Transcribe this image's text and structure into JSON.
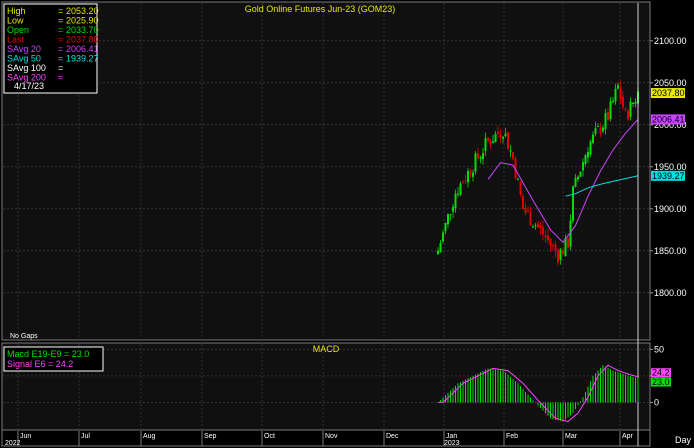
{
  "chart_data": [
    {
      "type": "candlestick",
      "title": "Gold  Online  Futures  Jun-23  (GOM23)",
      "info_box": {
        "rows": [
          {
            "label": "High",
            "value": "2053.20",
            "color": "#e8e800"
          },
          {
            "label": "Low",
            "value": "2025.90",
            "color": "#e8e800"
          },
          {
            "label": "Open",
            "value": "2033.70",
            "color": "#00e000"
          },
          {
            "label": "Last",
            "value": "2037.80",
            "color": "#e00000"
          },
          {
            "label": "SAvg  20",
            "value": "2006.41",
            "color": "#cc44ff"
          },
          {
            "label": "SAvg  50",
            "value": "1939.27",
            "color": "#00e0e0"
          },
          {
            "label": "SAvg  100",
            "value": "",
            "color": "#ffffff"
          },
          {
            "label": "SAvg  200",
            "value": "",
            "color": "#ff44ff"
          }
        ],
        "date": "4/17/23"
      },
      "note": "No Gaps",
      "ylim": [
        1745,
        2145
      ],
      "y_ticks": [
        1800,
        1850,
        1900,
        1950,
        2000,
        2050,
        2100
      ],
      "tags": [
        {
          "value": 2037.8,
          "label": "2037.80",
          "bg": "#e8e800",
          "fg": "#000000"
        },
        {
          "value": 2006.41,
          "label": "2006.41",
          "bg": "#cc44ff",
          "fg": "#000000"
        },
        {
          "value": 1939.27,
          "label": "1939.27",
          "bg": "#00e0e0",
          "fg": "#000000"
        }
      ],
      "x_axis": {
        "months": [
          "Jun",
          "Jul",
          "Aug",
          "Sep",
          "Oct",
          "Nov",
          "Dec",
          "Jan",
          "Feb",
          "Mar",
          "Apr"
        ],
        "years": [
          "2022",
          "2023"
        ],
        "period": "Day"
      },
      "candles": {
        "up_color": "#00e000",
        "down_color": "#e00000",
        "anchors": [
          {
            "day": 0,
            "price": 1850
          },
          {
            "day": 7,
            "price": 1920
          },
          {
            "day": 20,
            "price": 1980
          },
          {
            "day": 26,
            "price": 1995
          },
          {
            "day": 30,
            "price": 1960
          },
          {
            "day": 34,
            "price": 1900
          },
          {
            "day": 42,
            "price": 1870
          },
          {
            "day": 48,
            "price": 1845
          },
          {
            "day": 52,
            "price": 1860
          },
          {
            "day": 54,
            "price": 1920
          },
          {
            "day": 60,
            "price": 1975
          },
          {
            "day": 68,
            "price": 2010
          },
          {
            "day": 72,
            "price": 2045
          },
          {
            "day": 75,
            "price": 2010
          },
          {
            "day": 80,
            "price": 2038
          }
        ]
      },
      "sma20": {
        "color": "#cc44ff",
        "points": [
          {
            "day": 20,
            "price": 1935
          },
          {
            "day": 25,
            "price": 1955
          },
          {
            "day": 30,
            "price": 1952
          },
          {
            "day": 38,
            "price": 1910
          },
          {
            "day": 45,
            "price": 1875
          },
          {
            "day": 50,
            "price": 1860
          },
          {
            "day": 55,
            "price": 1880
          },
          {
            "day": 60,
            "price": 1915
          },
          {
            "day": 65,
            "price": 1945
          },
          {
            "day": 70,
            "price": 1970
          },
          {
            "day": 75,
            "price": 1990
          },
          {
            "day": 80,
            "price": 2006.41
          }
        ]
      },
      "sma50": {
        "color": "#00e0e0",
        "points": [
          {
            "day": 51,
            "price": 1915
          },
          {
            "day": 55,
            "price": 1918
          },
          {
            "day": 60,
            "price": 1925
          },
          {
            "day": 66,
            "price": 1930
          },
          {
            "day": 72,
            "price": 1934
          },
          {
            "day": 80,
            "price": 1939.27
          }
        ]
      }
    },
    {
      "type": "macd",
      "title": "MACD",
      "legend": [
        {
          "text": "Macd  E19-E9  =  23.0",
          "color": "#00e000"
        },
        {
          "text": "Signal  E6  =  24.2",
          "color": "#ff44ff"
        }
      ],
      "ylim": [
        -25,
        55
      ],
      "y_ticks": [
        0,
        25,
        50
      ],
      "tags": [
        {
          "value": 24.2,
          "label": "24.2",
          "bg": "#ff44ff",
          "fg": "#000000"
        },
        {
          "value": 23.0,
          "label": "23.0",
          "bg": "#00e000",
          "fg": "#000000"
        }
      ],
      "histogram_color": "#00e000",
      "signal_color": "#ff44ff",
      "anchors": [
        {
          "day": 0,
          "value": 0
        },
        {
          "day": 8,
          "value": 18
        },
        {
          "day": 20,
          "value": 32
        },
        {
          "day": 26,
          "value": 30
        },
        {
          "day": 32,
          "value": 18
        },
        {
          "day": 38,
          "value": 2
        },
        {
          "day": 45,
          "value": -15
        },
        {
          "day": 50,
          "value": -18
        },
        {
          "day": 54,
          "value": -10
        },
        {
          "day": 58,
          "value": 5
        },
        {
          "day": 62,
          "value": 25
        },
        {
          "day": 66,
          "value": 35
        },
        {
          "day": 70,
          "value": 30
        },
        {
          "day": 75,
          "value": 26
        },
        {
          "day": 80,
          "value": 23
        }
      ]
    }
  ]
}
